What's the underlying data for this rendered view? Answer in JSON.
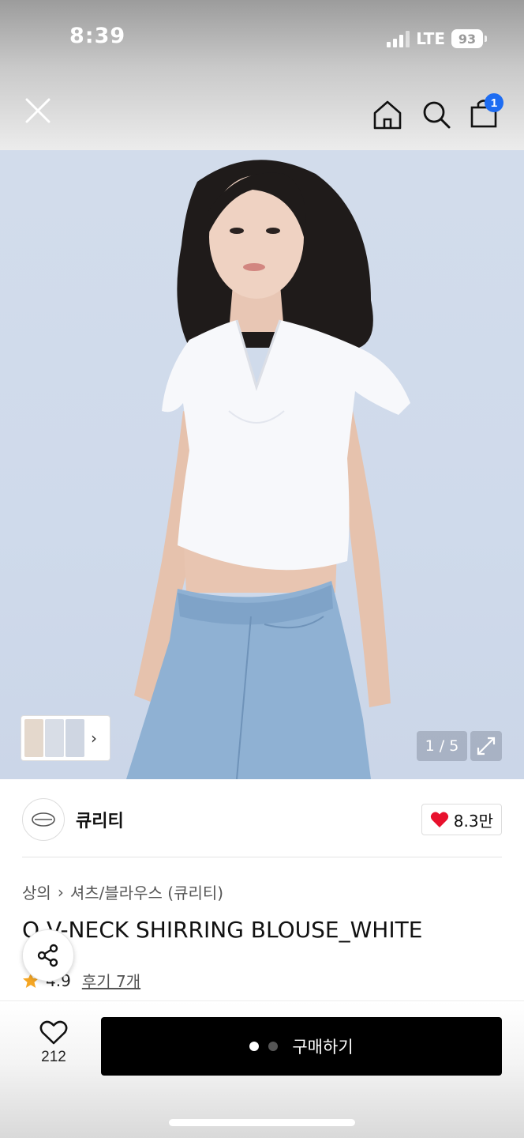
{
  "status_bar": {
    "time": "8:39",
    "network": "LTE",
    "battery": "93"
  },
  "header": {
    "close_icon": "close-icon",
    "home_icon": "home-icon",
    "search_icon": "search-icon",
    "cart_icon": "shopping-bag-icon",
    "cart_count": "1"
  },
  "gallery": {
    "counter": "1 / 5",
    "expand_icon": "expand-icon",
    "thumb_chevron": "›"
  },
  "brand": {
    "name": "큐리티",
    "like_count": "8.3만"
  },
  "product": {
    "breadcrumb": [
      "상의",
      "셔츠/블라우스 (큐리티)"
    ],
    "breadcrumb_sep": "›",
    "title": "Q V-NECK SHIRRING BLOUSE_WHITE",
    "rating": "4.9",
    "review_link": "후기 7개"
  },
  "bottom": {
    "wish_count": "212",
    "buy_label": "구매하기"
  },
  "colors": {
    "accent_badge": "#1d6cf2",
    "heart": "#e8112d",
    "star": "#f5a623",
    "buy_button": "#000000"
  }
}
